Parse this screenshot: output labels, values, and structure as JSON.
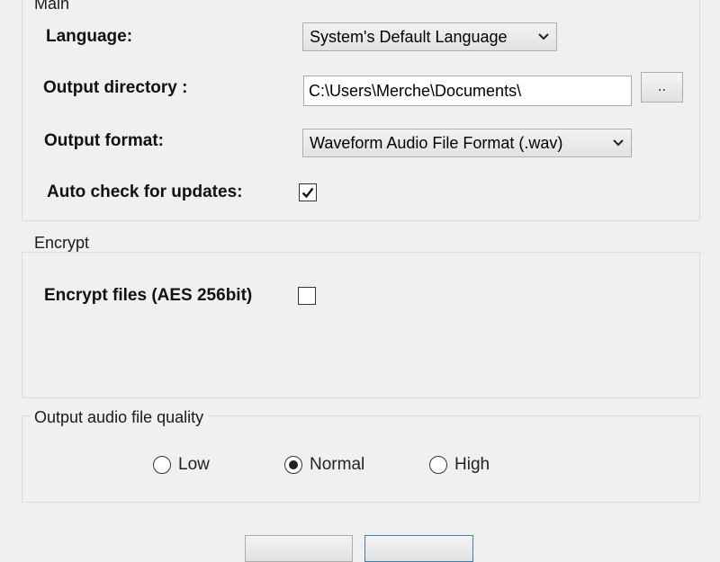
{
  "main_group": {
    "title": "Main",
    "language_label": "Language:",
    "language_value": "System's Default Language",
    "output_dir_label": "Output directory :",
    "output_dir_value": "C:\\Users\\Merche\\Documents\\",
    "browse_label": "..",
    "output_format_label": "Output format:",
    "output_format_value": "Waveform Audio File Format (.wav)",
    "auto_update_label": "Auto check for updates:",
    "auto_update_checked": true
  },
  "encrypt_group": {
    "title": "Encrypt",
    "encrypt_label": "Encrypt files (AES 256bit)",
    "encrypt_checked": false
  },
  "quality_group": {
    "title": "Output audio file quality",
    "options": [
      {
        "label": "Low",
        "selected": false
      },
      {
        "label": "Normal",
        "selected": true
      },
      {
        "label": "High",
        "selected": false
      }
    ]
  },
  "colors": {
    "background": "#f0f0f0",
    "group_border": "#dcdcdc",
    "default_button_border": "#3c7fb1"
  },
  "icons": {
    "dropdown": "chevron-down-icon",
    "check": "checkmark-icon",
    "radio_selected": "radio-dot-icon"
  }
}
